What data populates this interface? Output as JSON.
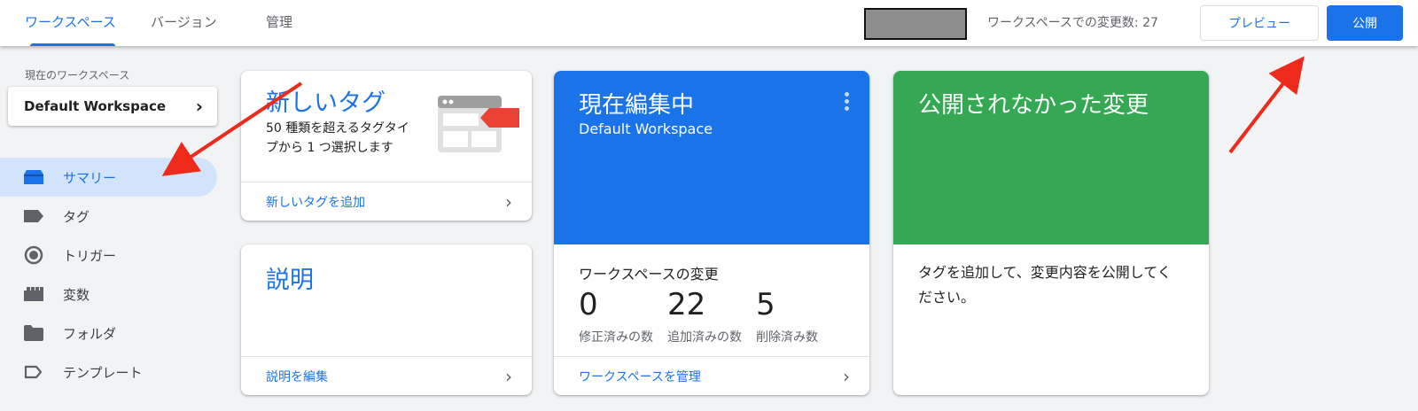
{
  "tabs": [
    {
      "label": "ワークスペース",
      "active": true
    },
    {
      "label": "バージョン",
      "active": false
    },
    {
      "label": "管理",
      "active": false
    }
  ],
  "header": {
    "change_count_text": "ワークスペースでの変更数: 27",
    "preview_label": "プレビュー",
    "publish_label": "公開"
  },
  "sidebar": {
    "workspace_caption": "現在のワークスペース",
    "workspace_name": "Default Workspace",
    "items": [
      {
        "label": "サマリー",
        "icon": "summary-icon",
        "active": true
      },
      {
        "label": "タグ",
        "icon": "tag-icon",
        "active": false
      },
      {
        "label": "トリガー",
        "icon": "trigger-icon",
        "active": false
      },
      {
        "label": "変数",
        "icon": "variable-icon",
        "active": false
      },
      {
        "label": "フォルダ",
        "icon": "folder-icon",
        "active": false
      },
      {
        "label": "テンプレート",
        "icon": "template-icon",
        "active": false
      }
    ]
  },
  "cards": {
    "new_tag": {
      "title": "新しいタグ",
      "description": "50 種類を超えるタグタイプから 1 つ選択します",
      "link": "新しいタグを追加"
    },
    "description": {
      "title": "説明",
      "link": "説明を編集"
    },
    "editing": {
      "title": "現在編集中",
      "subtitle": "Default Workspace",
      "changes_title": "ワークスペースの変更",
      "stats": [
        {
          "value": "0",
          "label": "修正済みの数"
        },
        {
          "value": "22",
          "label": "追加済みの数"
        },
        {
          "value": "5",
          "label": "削除済み数"
        }
      ],
      "link": "ワークスペースを管理"
    },
    "unpublished": {
      "title": "公開されなかった変更",
      "body": "タグを追加して、変更内容を公開してください。"
    }
  },
  "colors": {
    "accent": "#1a73e8",
    "editing_card": "#1a73e8",
    "unpublished_card": "#34a853",
    "annotation_arrow": "#ee2a1b"
  }
}
